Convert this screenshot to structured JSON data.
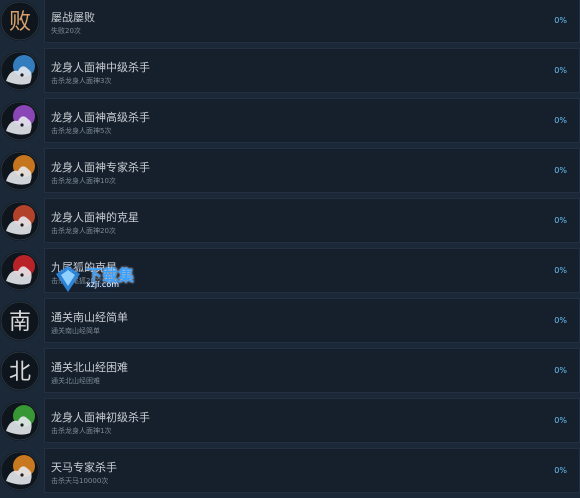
{
  "achievements": [
    {
      "title": "屡战屡败",
      "desc": "失败20次",
      "percent": "0%",
      "icon": "defeat-calligraphy-icon",
      "color": "#d9a36b",
      "glyph": "败"
    },
    {
      "title": "龙身人面神中级杀手",
      "desc": "击杀龙身人面神3次",
      "percent": "0%",
      "icon": "dragon-god-blue-icon",
      "color": "#3a8fdc",
      "glyph": ""
    },
    {
      "title": "龙身人面神高级杀手",
      "desc": "击杀龙身人面神5次",
      "percent": "0%",
      "icon": "dragon-god-purple-icon",
      "color": "#a04fd1",
      "glyph": ""
    },
    {
      "title": "龙身人面神专家杀手",
      "desc": "击杀龙身人面神10次",
      "percent": "0%",
      "icon": "dragon-god-orange-icon",
      "color": "#e5861e",
      "glyph": ""
    },
    {
      "title": "龙身人面神的克星",
      "desc": "击杀龙身人面神20次",
      "percent": "0%",
      "icon": "dragon-god-red-icon",
      "color": "#d04a2e",
      "glyph": ""
    },
    {
      "title": "九尾狐的克星",
      "desc": "击杀九尾狐20次",
      "percent": "0%",
      "icon": "nine-tailed-fox-icon",
      "color": "#d6262a",
      "glyph": ""
    },
    {
      "title": "通关南山经简单",
      "desc": "通关南山经简单",
      "percent": "0%",
      "icon": "south-mountain-calligraphy-icon",
      "color": "#d8d8d8",
      "glyph": "南"
    },
    {
      "title": "通关北山经困难",
      "desc": "通关北山经困难",
      "percent": "0%",
      "icon": "north-mountain-calligraphy-icon",
      "color": "#d8d8d8",
      "glyph": "北"
    },
    {
      "title": "龙身人面神初级杀手",
      "desc": "击杀龙身人面神1次",
      "percent": "0%",
      "icon": "dragon-god-green-icon",
      "color": "#3fae3a",
      "glyph": ""
    },
    {
      "title": "天马专家杀手",
      "desc": "击杀天马10000次",
      "percent": "0%",
      "icon": "heavenly-horse-icon",
      "color": "#e98a1e",
      "glyph": ""
    }
  ],
  "watermark": {
    "name": "下载集",
    "domain": "xzji.com"
  }
}
